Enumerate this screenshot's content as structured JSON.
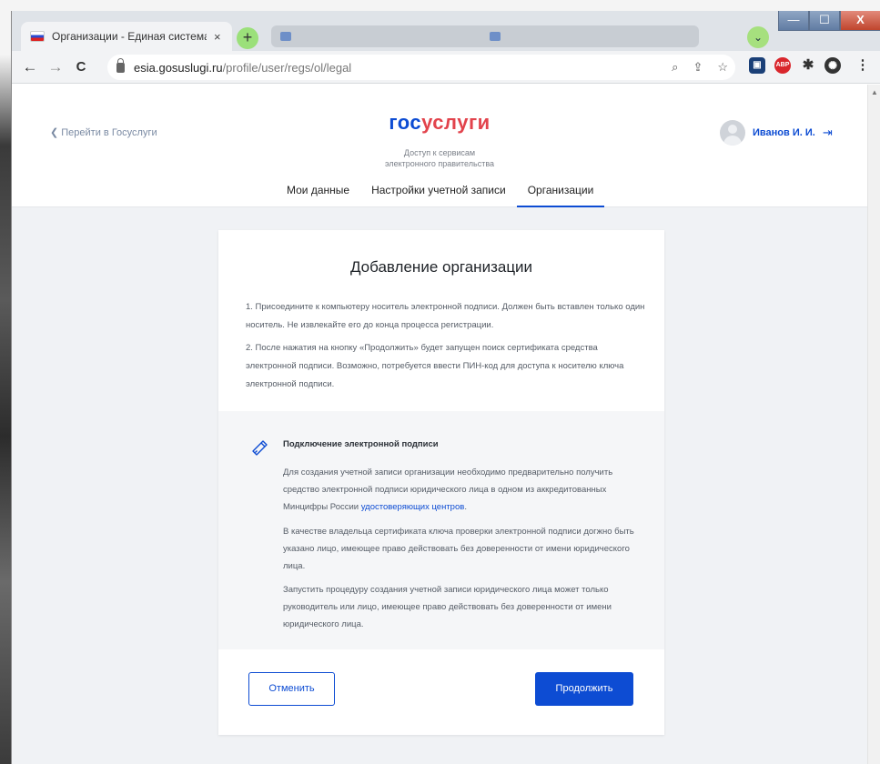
{
  "browser": {
    "tab_title": "Организации - Единая система",
    "tab_close": "×",
    "new_tab": "+",
    "tabs_menu": "⌄",
    "window_controls": {
      "minimize": "—",
      "maximize": "☐",
      "close": "X"
    },
    "nav": {
      "back": "←",
      "forward": "→",
      "reload": "C"
    },
    "url_host": "esia.gosuslugi.ru",
    "url_path": "/profile/user/regs/ol/legal",
    "omnibox_icons": {
      "zoom": "🔍",
      "share": "⇪",
      "bookmark": "☆"
    },
    "extensions": [
      "bookmark-ext-icon",
      "adblock-icon",
      "puzzle-icon",
      "profile-icon"
    ],
    "extension_abp_label": "ABP",
    "menu": "⋮"
  },
  "header": {
    "back_link": "❮ Перейти в Госуслуги",
    "logo_part1": "гос",
    "logo_part2": "услуги",
    "subtitle_line1": "Доступ к сервисам",
    "subtitle_line2": "электронного правительства",
    "user_name": "Иванов И. И.",
    "logout_icon": "⇥",
    "nav": [
      {
        "label": "Мои данные"
      },
      {
        "label": "Настройки учетной записи"
      },
      {
        "label": "Организации"
      }
    ]
  },
  "card": {
    "title": "Добавление организации",
    "step1": "1. Присоедините к компьютеру носитель электронной подписи. Должен быть вставлен только один носитель. Не извлекайте его до конца процесса регистрации.",
    "step2": "2. После нажатия на кнопку «Продолжить» будет запущен поиск сертификата средства электронной подписи. Возможно, потребуется ввести ПИН-код для доступа к носителю ключа электронной подписи.",
    "info_title": "Подключение электронной подписи",
    "info_p1_text": "Для создания учетной записи организации необходимо предварительно получить средство электронной подписи юридического лица в одном из аккредитованных Минцифры России ",
    "info_p1_link": "удостоверяющих центров",
    "info_p1_end": ".",
    "info_p2": "В качестве владельца сертификата ключа проверки электронной подписи догжно быть указано лицо, имеющее право действовать без доверенности от имени юридического лица.",
    "info_p3": "Запустить процедуру создания учетной записи юридического лица может только руководитель или лицо, имеющее право действовать без доверенности от имени юридического лица.",
    "cancel_label": "Отменить",
    "continue_label": "Продолжить"
  },
  "colors": {
    "brand_blue": "#0d4cd3",
    "brand_red": "#e2434c",
    "page_bg": "#f0f2f5"
  }
}
